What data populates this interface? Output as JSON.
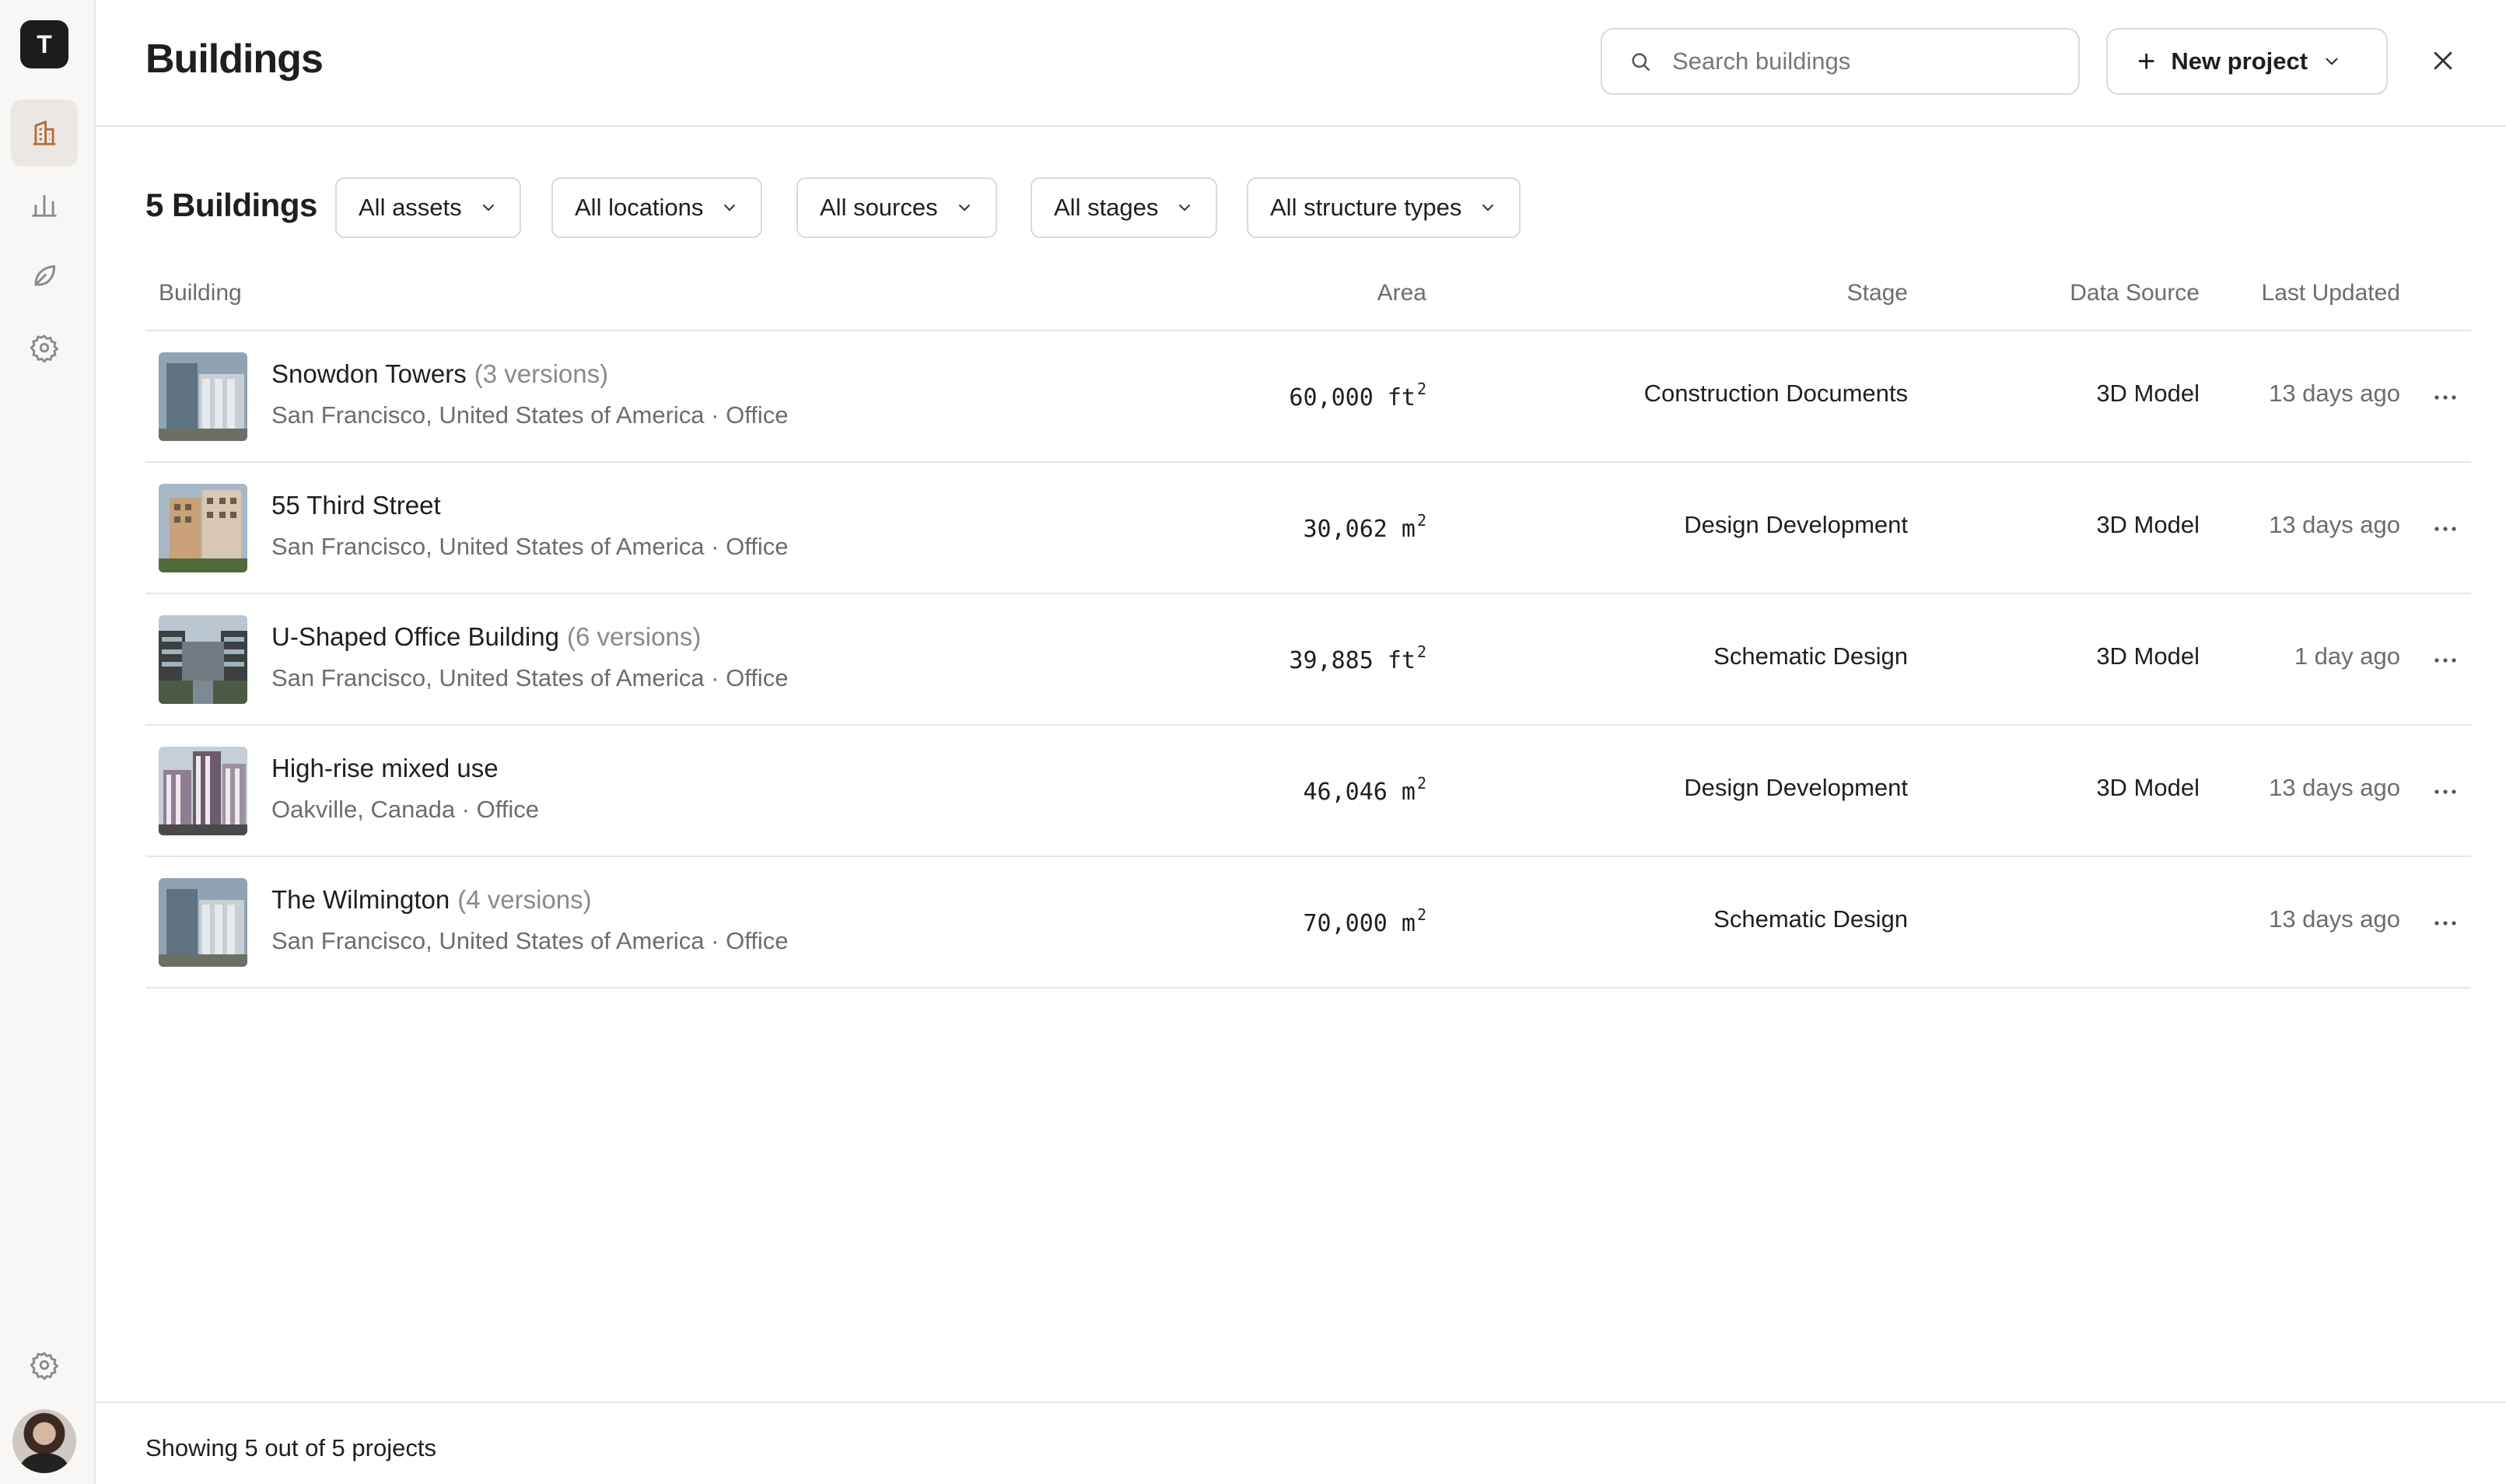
{
  "app": {
    "logo_letter": "T"
  },
  "sidebar": {
    "items": [
      {
        "icon": "building-icon",
        "active": true
      },
      {
        "icon": "bar-chart-icon",
        "active": false
      },
      {
        "icon": "leaf-icon",
        "active": false
      },
      {
        "icon": "settings-icon",
        "active": false
      }
    ],
    "bottom_icon": "settings-icon"
  },
  "header": {
    "title": "Buildings",
    "search_placeholder": "Search buildings",
    "new_project_label": "New project"
  },
  "toolbar": {
    "count_title": "5 Buildings",
    "filters": [
      "All assets",
      "All locations",
      "All sources",
      "All stages",
      "All structure types"
    ]
  },
  "table": {
    "columns": [
      "Building",
      "Area",
      "Stage",
      "Data Source",
      "Last Updated"
    ],
    "rows": [
      {
        "name": "Snowdon Towers",
        "versions": "(3 versions)",
        "location": "San Francisco, United States of America · Office",
        "area_value": "60,000",
        "area_unit": "ft",
        "area_exp": "2",
        "stage": "Construction Documents",
        "source": "3D Model",
        "updated": "13 days ago"
      },
      {
        "name": "55 Third Street",
        "versions": "",
        "location": "San Francisco, United States of America · Office",
        "area_value": "30,062",
        "area_unit": "m",
        "area_exp": "2",
        "stage": "Design Development",
        "source": "3D Model",
        "updated": "13 days ago"
      },
      {
        "name": "U-Shaped Office Building",
        "versions": "(6 versions)",
        "location": "San Francisco, United States of America · Office",
        "area_value": "39,885",
        "area_unit": "ft",
        "area_exp": "2",
        "stage": "Schematic Design",
        "source": "3D Model",
        "updated": "1 day ago"
      },
      {
        "name": "High-rise mixed use",
        "versions": "",
        "location": "Oakville, Canada · Office",
        "area_value": "46,046",
        "area_unit": "m",
        "area_exp": "2",
        "stage": "Design Development",
        "source": "3D Model",
        "updated": "13 days ago"
      },
      {
        "name": "The Wilmington",
        "versions": "(4 versions)",
        "location": "San Francisco, United States of America · Office",
        "area_value": "70,000",
        "area_unit": "m",
        "area_exp": "2",
        "stage": "Schematic Design",
        "source": "",
        "updated": "13 days ago"
      }
    ]
  },
  "footer": {
    "text": "Showing 5 out of 5 projects"
  },
  "colors": {
    "border": "#e8e6e2",
    "sidebar_bg": "#f8f7f5",
    "active_nav": "#ebe8e4",
    "text": "#1f1f1f",
    "muted": "#6d6d6d"
  }
}
